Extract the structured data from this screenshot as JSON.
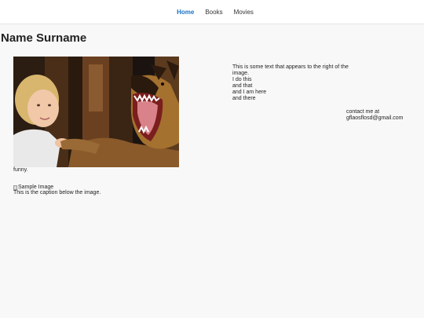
{
  "nav": {
    "items": [
      {
        "label": "Home",
        "active": true
      },
      {
        "label": "Books",
        "active": false
      },
      {
        "label": "Movies",
        "active": false
      }
    ],
    "active_color": "#1a73c8"
  },
  "page_title": "Name Surname",
  "photo": {
    "alt": "girl with an angry german shepherd dog",
    "caption": "funny."
  },
  "side_text": {
    "lines": [
      "This is some text that appears to the right of the image.",
      "I do this",
      "and that",
      "and I am here",
      "and there"
    ]
  },
  "contact": {
    "label": "contact me at",
    "email": "gflaosflosd@gmail.com"
  },
  "sample": {
    "alt": "Sample Image",
    "caption": "This is the caption below the image."
  }
}
